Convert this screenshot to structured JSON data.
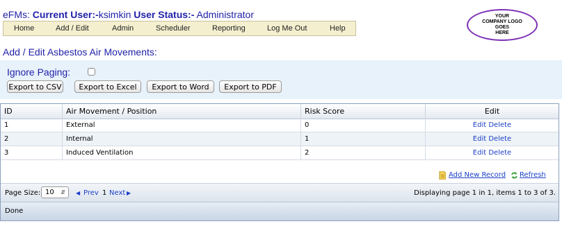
{
  "header": {
    "app_prefix": "eFMs: ",
    "current_user_label": "Current User:-",
    "current_user": "ksimkin",
    "user_status_label": "User Status:-",
    "user_status": "Administrator"
  },
  "menu": [
    "Home",
    "Add / Edit",
    "Admin",
    "Scheduler",
    "Reporting",
    "Log Me Out",
    "Help"
  ],
  "logo": {
    "line1": "YOUR",
    "line2": "COMPANY LOGO",
    "line3": "GOES",
    "line4": "HERE"
  },
  "page_title": "Add / Edit Asbestos Air Movements:",
  "paging": {
    "ignore_label": "Ignore Paging:",
    "ignore_checked": false
  },
  "export_buttons": [
    "Export to CSV",
    "Export to Excel",
    "Export to Word",
    "Export to PDF"
  ],
  "grid": {
    "columns": [
      "ID",
      "Air Movement / Position",
      "Risk Score",
      "Edit"
    ],
    "rows": [
      {
        "id": "1",
        "name": "External",
        "risk": "0",
        "edit": "Edit",
        "delete": "Delete"
      },
      {
        "id": "2",
        "name": "Internal",
        "risk": "1",
        "edit": "Edit",
        "delete": "Delete"
      },
      {
        "id": "3",
        "name": "Induced Ventilation",
        "risk": "2",
        "edit": "Edit",
        "delete": "Delete"
      }
    ],
    "add_new": "Add New Record",
    "refresh": "Refresh",
    "page_size_label": "Page Size:",
    "page_size": "10",
    "prev_label": "Prev",
    "page_number": "1",
    "next_label": "Next",
    "page_info": "Displaying page 1 in 1, items 1 to 3 of 3."
  },
  "status": "Done",
  "colors": {
    "title_blue": "#1f1fa8",
    "link_blue": "#1a3fc7",
    "panel_bg": "#e8f2fb",
    "menu_bg": "#f4efcf",
    "logo_border": "#7b2fb5"
  },
  "icons": {
    "add_icon": "document-add-icon",
    "refresh_icon": "refresh-arrows-icon",
    "prev_icon": "triangle-left-icon",
    "next_icon": "triangle-right-icon",
    "select_icon": "updown-arrows-icon"
  }
}
